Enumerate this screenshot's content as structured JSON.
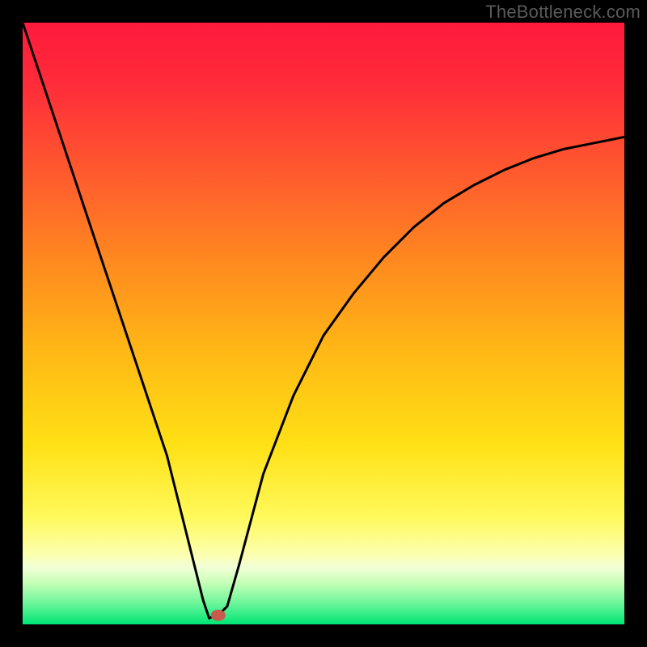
{
  "watermark": "TheBottleneck.com",
  "chart_data": {
    "type": "line",
    "title": "",
    "xlabel": "",
    "ylabel": "",
    "xlim": [
      0,
      100
    ],
    "ylim": [
      0,
      100
    ],
    "x_optimum": 31,
    "marker": {
      "x": 32.5,
      "y": 1.5,
      "color": "#c7594d"
    },
    "series": [
      {
        "name": "bottleneck-curve",
        "x": [
          0,
          4,
          8,
          12,
          16,
          20,
          24,
          27,
          29,
          30,
          31,
          32,
          33,
          34,
          36,
          40,
          45,
          50,
          55,
          60,
          65,
          70,
          75,
          80,
          85,
          90,
          95,
          100
        ],
        "values": [
          100,
          88,
          76,
          64,
          52,
          40,
          28,
          16,
          8,
          4,
          1,
          1.5,
          2,
          3,
          10,
          25,
          38,
          48,
          55,
          61,
          66,
          70,
          73,
          75.5,
          77.5,
          79,
          80,
          81
        ]
      }
    ],
    "background_gradient": {
      "top": "#ff2040",
      "mid": "#ffd200",
      "bottom_band": "#faffc0",
      "bottom": "#00e676"
    }
  }
}
